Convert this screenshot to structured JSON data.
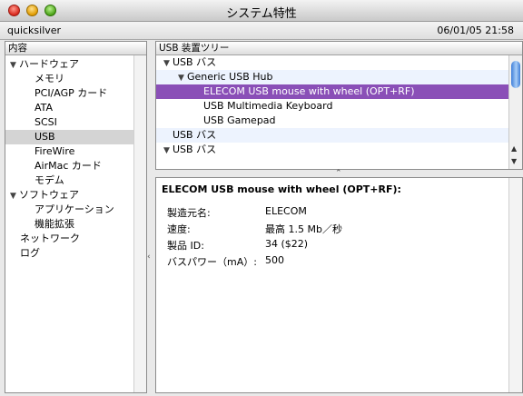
{
  "window": {
    "title": "システム特性"
  },
  "infobar": {
    "machine_name": "quicksilver",
    "datetime": "06/01/05 21:58"
  },
  "sidebar": {
    "header": "内容",
    "hardware": {
      "label": "ハードウェア",
      "items": [
        "メモリ",
        "PCI/AGP カード",
        "ATA",
        "SCSI",
        "USB",
        "FireWire",
        "AirMac カード",
        "モデム"
      ],
      "selected": "USB"
    },
    "software": {
      "label": "ソフトウェア",
      "items": [
        "アプリケーション",
        "機能拡張"
      ]
    },
    "network": "ネットワーク",
    "logs": "ログ"
  },
  "usb_tree": {
    "header": "USB 装置ツリー",
    "bus_label": "USB バス",
    "hub_label": "Generic USB Hub",
    "devices": [
      "ELECOM USB mouse with wheel (OPT+RF)",
      "USB Multimedia Keyboard",
      "USB Gamepad"
    ],
    "selected": "ELECOM USB mouse with wheel (OPT+RF)"
  },
  "details": {
    "title": "ELECOM USB mouse with wheel (OPT+RF):",
    "properties": [
      {
        "label": "製造元名:",
        "value": "ELECOM"
      },
      {
        "label": "速度:",
        "value": "最高 1.5 Mb／秒"
      },
      {
        "label": "製品 ID:",
        "value": "34 ($22)"
      },
      {
        "label": "バスパワー（mA）:",
        "value": "500"
      }
    ]
  },
  "colors": {
    "selection": "#8a4fb7",
    "stripe": "#edf3fe",
    "scroll_thumb": "#3f7ed9"
  }
}
